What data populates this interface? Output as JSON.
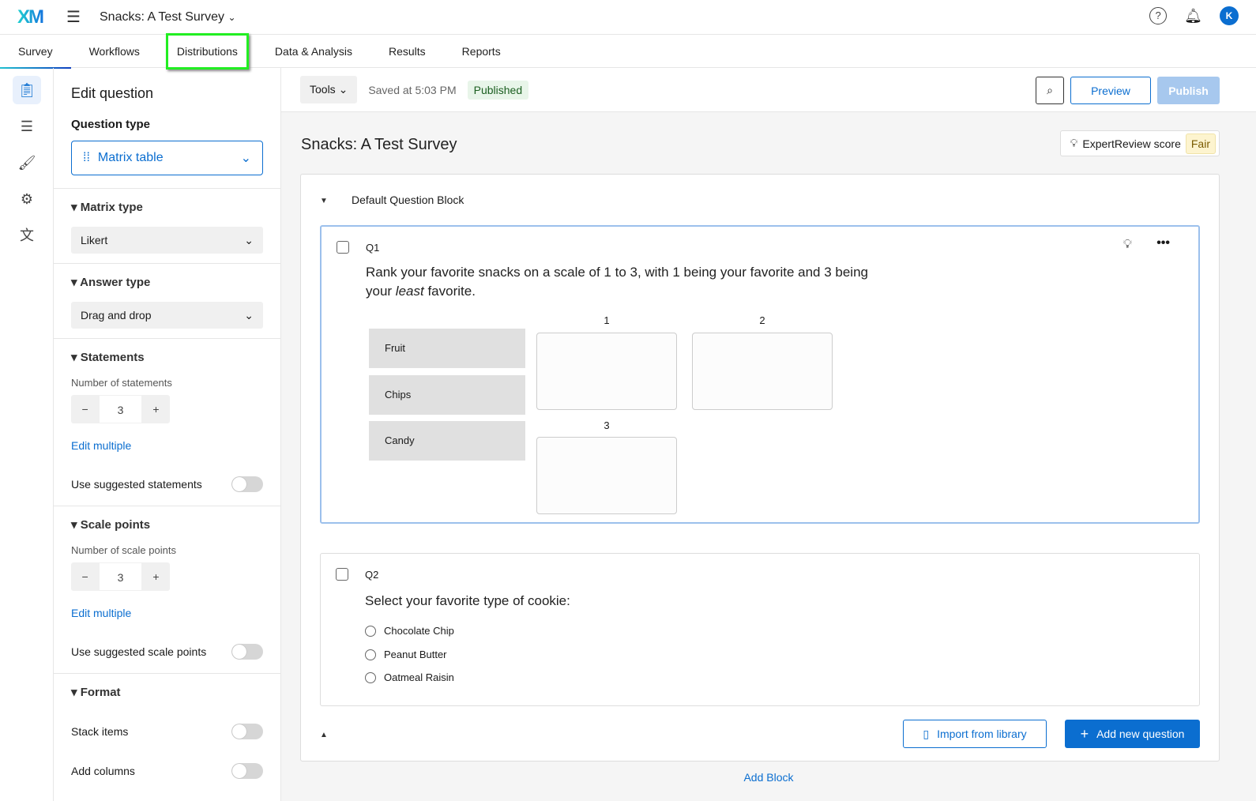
{
  "header": {
    "logo": "XM",
    "survey_title": "Snacks: A Test Survey",
    "avatar_initial": "K"
  },
  "tabs": [
    "Survey",
    "Workflows",
    "Distributions",
    "Data & Analysis",
    "Results",
    "Reports"
  ],
  "panel": {
    "title": "Edit question",
    "question_type_label": "Question type",
    "question_type": "Matrix table",
    "matrix_type_label": "Matrix type",
    "matrix_type": "Likert",
    "answer_type_label": "Answer type",
    "answer_type": "Drag and drop",
    "statements_label": "Statements",
    "num_statements_label": "Number of statements",
    "num_statements": "3",
    "edit_multiple": "Edit multiple",
    "use_suggested_statements": "Use suggested statements",
    "scale_points_label": "Scale points",
    "num_scale_label": "Number of scale points",
    "num_scale": "3",
    "use_suggested_scale": "Use suggested scale points",
    "format_label": "Format",
    "stack_items": "Stack items",
    "add_columns": "Add columns"
  },
  "toolbar": {
    "tools": "Tools",
    "saved": "Saved at 5:03 PM",
    "status": "Published",
    "preview": "Preview",
    "publish": "Publish"
  },
  "survey": {
    "title": "Snacks: A Test Survey",
    "expert_review": "ExpertReview score",
    "score": "Fair",
    "block_name": "Default Question Block",
    "q1": {
      "num": "Q1",
      "text_a": "Rank your favorite snacks on a scale of 1 to 3, with 1 being your favorite and 3 being",
      "text_b": "your ",
      "text_em": "least",
      "text_c": " favorite.",
      "items": [
        "Fruit",
        "Chips",
        "Candy"
      ],
      "groups": [
        "1",
        "2",
        "3"
      ]
    },
    "q2": {
      "num": "Q2",
      "text": "Select your favorite type of cookie:",
      "options": [
        "Chocolate Chip",
        "Peanut Butter",
        "Oatmeal Raisin"
      ]
    },
    "import": "Import from library",
    "add_question": "Add new question",
    "add_block": "Add Block"
  }
}
